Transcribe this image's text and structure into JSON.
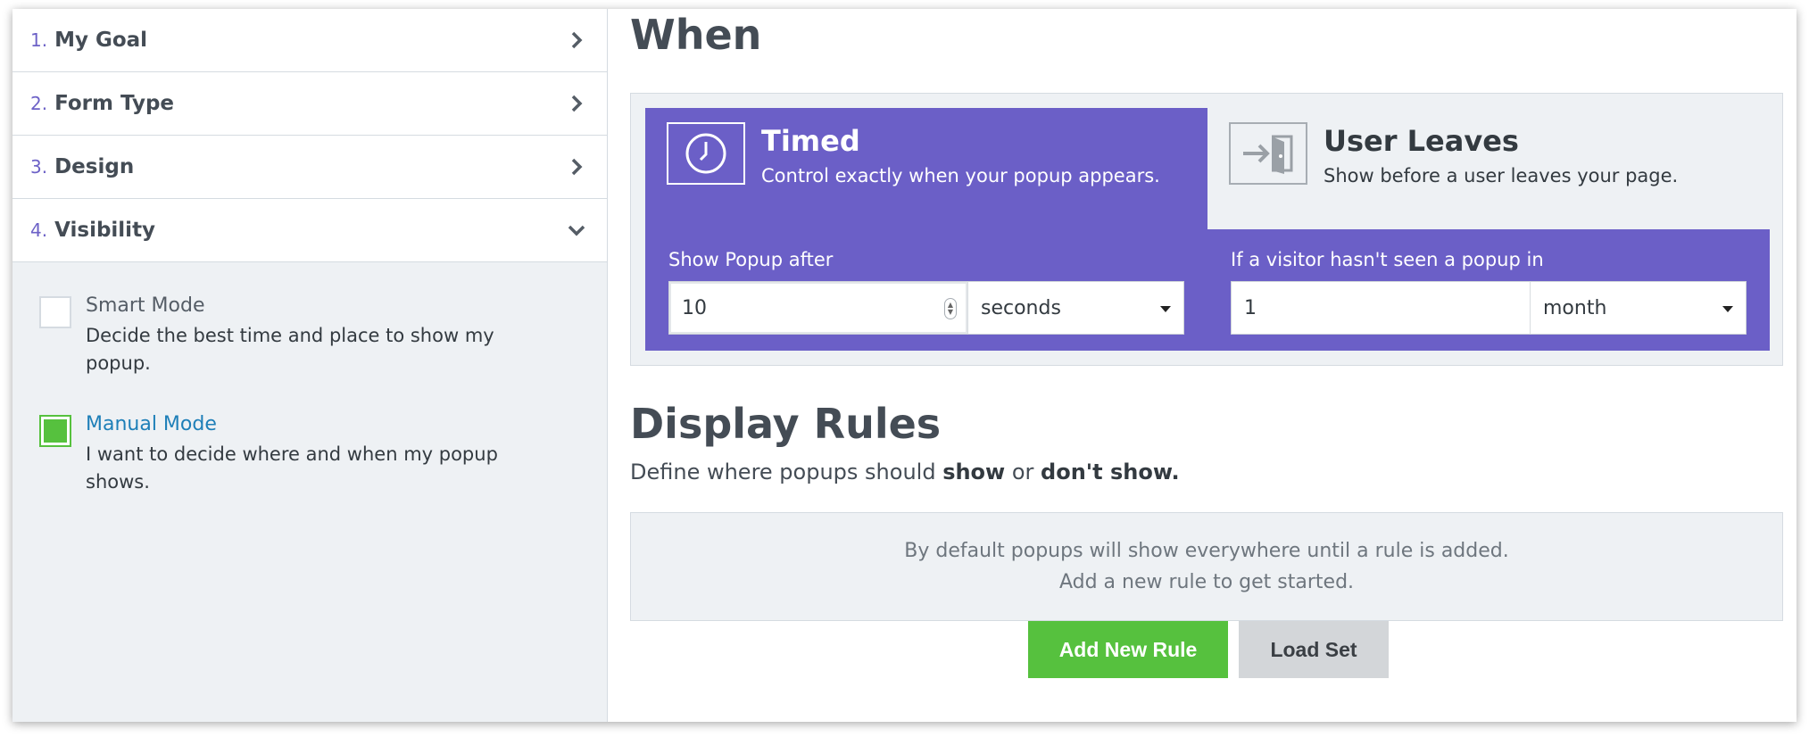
{
  "sidebar": {
    "steps": [
      {
        "num": "1.",
        "title": "My Goal",
        "state": "collapsed"
      },
      {
        "num": "2.",
        "title": "Form Type",
        "state": "collapsed"
      },
      {
        "num": "3.",
        "title": "Design",
        "state": "collapsed"
      },
      {
        "num": "4.",
        "title": "Visibility",
        "state": "expanded"
      }
    ],
    "modes": [
      {
        "title": "Smart Mode",
        "desc": "Decide the best time and place to show my popup.",
        "checked": false
      },
      {
        "title": "Manual Mode",
        "desc": "I want to decide where and when my popup shows.",
        "checked": true
      }
    ]
  },
  "when": {
    "heading": "When",
    "tabs": [
      {
        "title": "Timed",
        "desc": "Control exactly when your popup appears.",
        "icon": "clock-icon",
        "active": true
      },
      {
        "title": "User Leaves",
        "desc": "Show before a user leaves your page.",
        "icon": "exit-door-icon",
        "active": false
      }
    ],
    "show_after": {
      "label": "Show Popup after",
      "value": "10",
      "unit": "seconds"
    },
    "not_seen": {
      "label": "If a visitor hasn't seen a popup in",
      "value": "1",
      "unit": "month"
    }
  },
  "rules": {
    "heading": "Display Rules",
    "sub_prefix": "Define where popups should ",
    "sub_show": "show",
    "sub_or": " or ",
    "sub_dont": "don't show.",
    "empty_line1": "By default popups will show everywhere until a rule is added.",
    "empty_line2": "Add a new rule to get started.",
    "add_button": "Add New Rule",
    "load_button": "Load Set"
  },
  "colors": {
    "accent": "#6b5fc7",
    "success": "#56c13e",
    "link": "#1e7fb8",
    "panel_bg": "#eef1f4"
  }
}
